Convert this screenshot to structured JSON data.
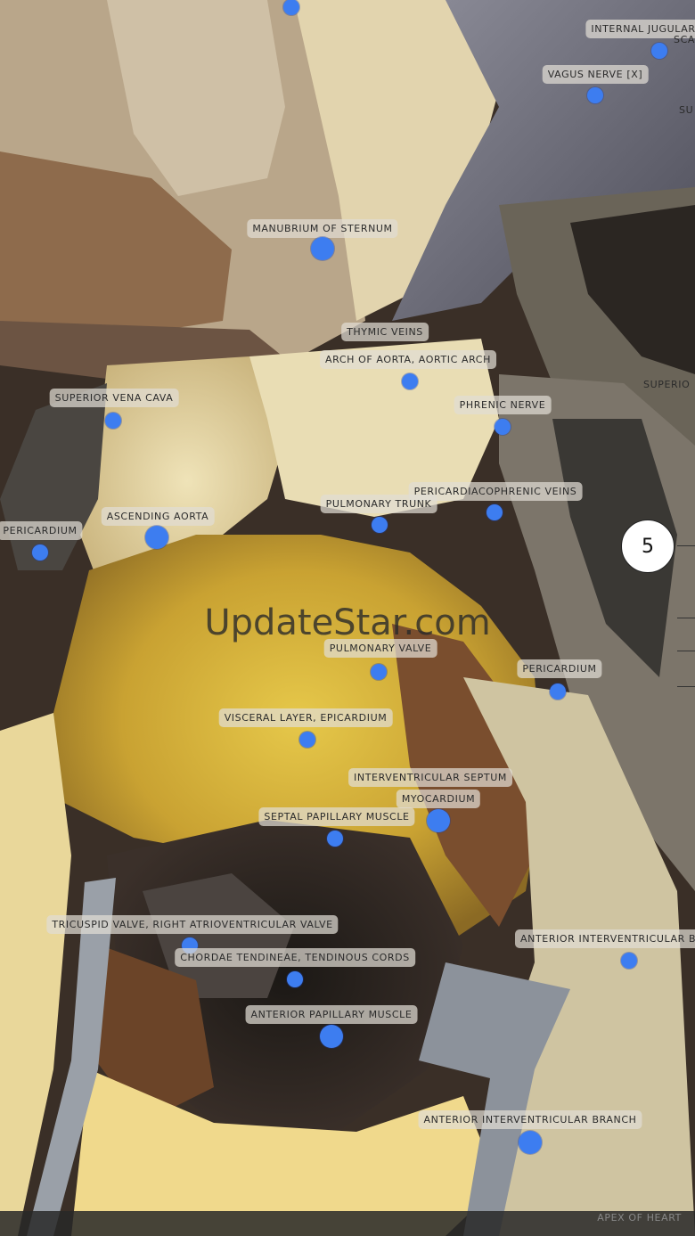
{
  "watermark": "UpdateStar.com",
  "step_number": "5",
  "bottom_label": "APEX OF HEART",
  "marker_color": "#3d7df0",
  "labels": {
    "internal_jugular": "INTERNAL JUGULAR",
    "internal_jugular_2": "SCA",
    "vagus_nerve": "VAGUS NERVE [X]",
    "su_edge": "SU",
    "manubrium": "MANUBRIUM OF STERNUM",
    "thymic_veins": "THYMIC VEINS",
    "arch_of_aorta": "ARCH OF AORTA, AORTIC ARCH",
    "superior_vena_cava": "SUPERIOR VENA CAVA",
    "superio_edge": "SUPERIO",
    "phrenic_nerve": "PHRENIC NERVE",
    "pericardiacophrenic": "PERICARDIACOPHRENIC VEINS",
    "pulmonary_trunk": "PULMONARY TRUNK",
    "ascending_aorta": "ASCENDING AORTA",
    "pericardium_left": "PERICARDIUM",
    "pulmonary_valve": "PULMONARY VALVE",
    "pericardium_right": "PERICARDIUM",
    "visceral_layer": "VISCERAL LAYER, EPICARDIUM",
    "interventricular_septum": "INTERVENTRICULAR SEPTUM",
    "myocardium": "MYOCARDIUM",
    "septal_papillary": "SEPTAL PAPILLARY MUSCLE",
    "tricuspid_valve": "TRICUSPID VALVE, RIGHT ATRIOVENTRICULAR VALVE",
    "anterior_interventricular_e": "ANTERIOR INTERVENTRICULAR B",
    "chordae_tendineae": "CHORDAE TENDINEAE, TENDINOUS CORDS",
    "anterior_papillary": "ANTERIOR PAPILLARY MUSCLE",
    "anterior_interventricular_branch": "ANTERIOR INTERVENTRICULAR BRANCH"
  }
}
